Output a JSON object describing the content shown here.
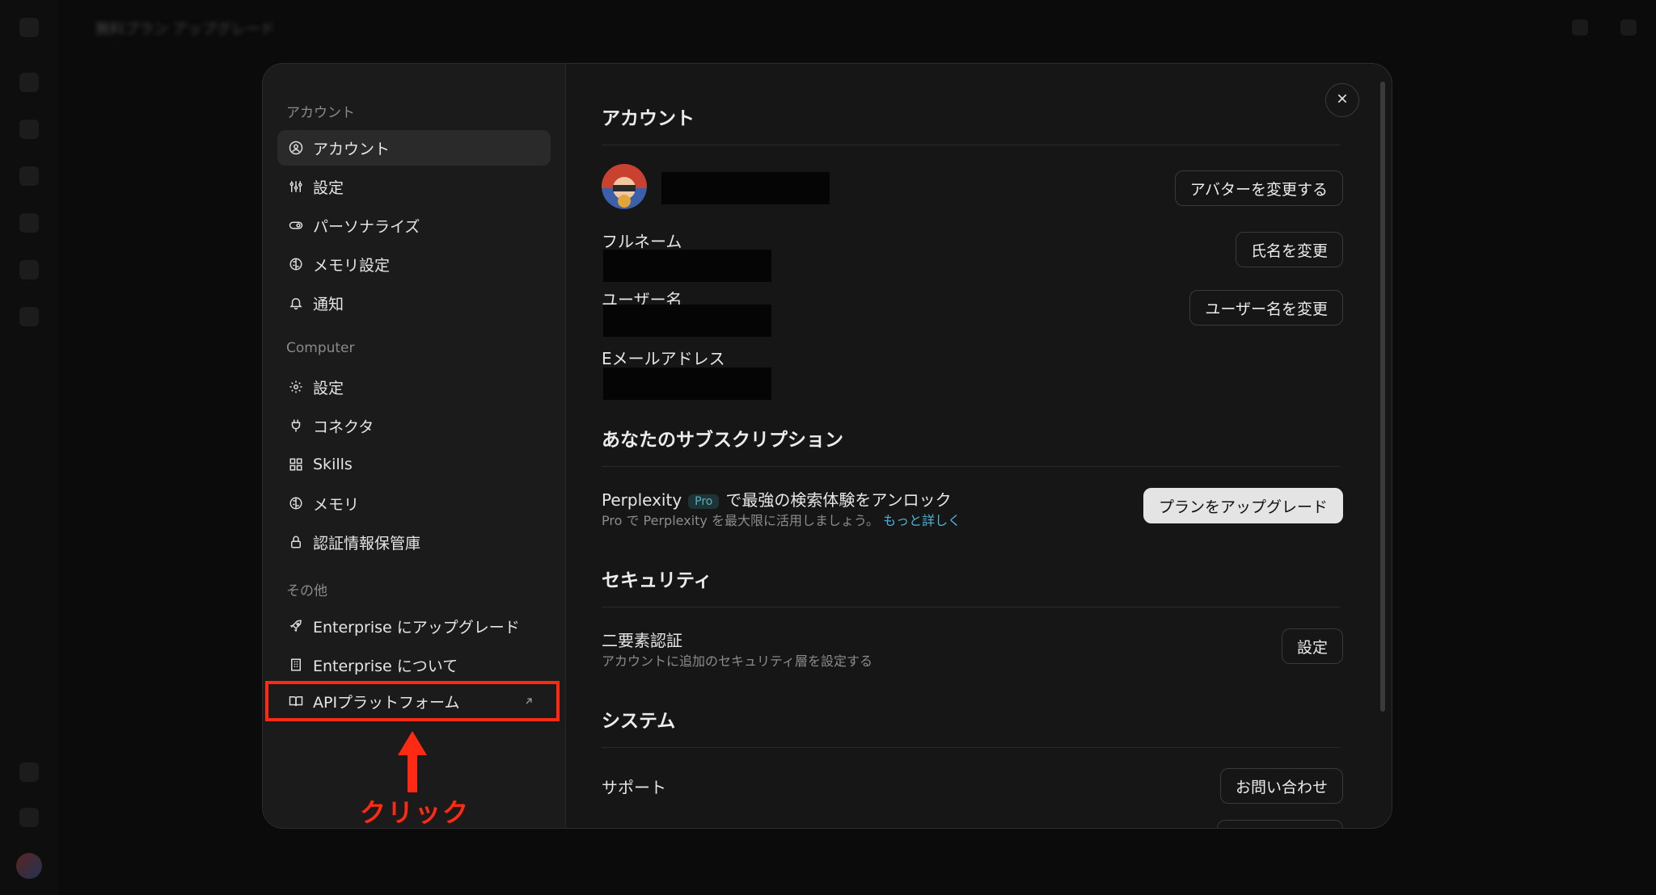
{
  "background": {
    "title": "無料プラン アップグレード"
  },
  "sidebar": {
    "sections": [
      {
        "title": "アカウント",
        "items": [
          {
            "label": "アカウント",
            "icon": "user-circle-icon",
            "active": true
          },
          {
            "label": "設定",
            "icon": "sliders-icon"
          },
          {
            "label": "パーソナライズ",
            "icon": "toggle-icon"
          },
          {
            "label": "メモリ設定",
            "icon": "brain-icon"
          },
          {
            "label": "通知",
            "icon": "bell-icon"
          }
        ]
      },
      {
        "title": "Computer",
        "items": [
          {
            "label": "設定",
            "icon": "gear-icon"
          },
          {
            "label": "コネクタ",
            "icon": "plug-icon"
          },
          {
            "label": "Skills",
            "icon": "blocks-icon"
          },
          {
            "label": "メモリ",
            "icon": "brain-icon"
          },
          {
            "label": "認証情報保管庫",
            "icon": "lock-icon"
          }
        ]
      },
      {
        "title": "その他",
        "items": [
          {
            "label": "Enterprise にアップグレード",
            "icon": "rocket-icon"
          },
          {
            "label": "Enterprise について",
            "icon": "building-icon"
          },
          {
            "label": "APIプラットフォーム",
            "icon": "book-icon",
            "external": true
          }
        ]
      }
    ]
  },
  "annotation": {
    "label": "クリック",
    "color": "#ff2a14"
  },
  "account": {
    "title": "アカウント",
    "change_avatar": "アバターを変更する",
    "fullname_label": "フルネーム",
    "change_name": "氏名を変更",
    "username_label": "ユーザー名",
    "change_username": "ユーザー名を変更",
    "email_label": "Eメールアドレス"
  },
  "subscription": {
    "title": "あなたのサブスクリプション",
    "brand": "Perplexity",
    "badge": "Pro",
    "headline_rest": "で最強の検索体験をアンロック",
    "sub_text": "Pro で Perplexity を最大限に活用しましょう。",
    "link": "もっと詳しく",
    "upgrade_button": "プランをアップグレード"
  },
  "security": {
    "title": "セキュリティ",
    "twofa_label": "二要素認証",
    "twofa_sub": "アカウントに追加のセキュリティ層を設定する",
    "setup_button": "設定"
  },
  "system": {
    "title": "システム",
    "support_label": "サポート",
    "contact_button": "お問い合わせ"
  }
}
